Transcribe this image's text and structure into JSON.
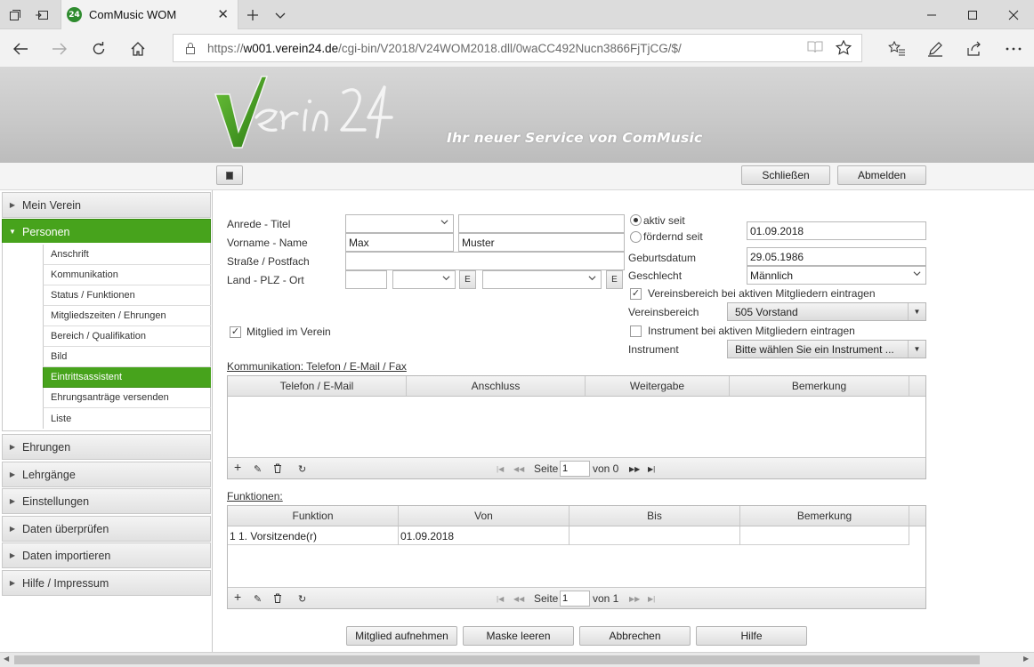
{
  "browser": {
    "tab_title": "ComMusic WOM",
    "favicon_text": "24",
    "url_prefix": "https://",
    "url_domain": "w001.verein24.de",
    "url_path": "/cgi-bin/V2018/V24WOM2018.dll/0waCC492Nucn3866FjTjCG/$/"
  },
  "header": {
    "logo_text": "Verein 24",
    "slogan": "Ihr neuer Service von ComMusic",
    "close_label": "Schließen",
    "logout_label": "Abmelden"
  },
  "sidebar": {
    "top_items": [
      {
        "label": "Mein Verein"
      },
      {
        "label": "Personen"
      }
    ],
    "sub_items": [
      {
        "label": "Anschrift"
      },
      {
        "label": "Kommunikation"
      },
      {
        "label": "Status / Funktionen"
      },
      {
        "label": "Mitgliedszeiten / Ehrungen"
      },
      {
        "label": "Bereich / Qualifikation"
      },
      {
        "label": "Bild"
      },
      {
        "label": "Eintrittsassistent"
      },
      {
        "label": "Ehrungsanträge versenden"
      },
      {
        "label": "Liste"
      }
    ],
    "bottom_items": [
      {
        "label": "Ehrungen"
      },
      {
        "label": "Lehrgänge"
      },
      {
        "label": "Einstellungen"
      },
      {
        "label": "Daten überprüfen"
      },
      {
        "label": "Daten importieren"
      },
      {
        "label": "Hilfe / Impressum"
      }
    ]
  },
  "form": {
    "anrede_label": "Anrede - Titel",
    "anrede_value": "",
    "titel_value": "",
    "name_label": "Vorname - Name",
    "vorname_value": "Max",
    "nachname_value": "Muster",
    "strasse_label": "Straße / Postfach",
    "strasse_value": "",
    "ort_label": "Land - PLZ - Ort",
    "land_value": "",
    "plz_value": "",
    "ort_value": "",
    "e_label": "E",
    "aktiv_label": "aktiv seit",
    "foerdernd_label": "fördernd seit",
    "aktiv_date": "01.09.2018",
    "geburtsdatum_label": "Geburtsdatum",
    "geburtsdatum_value": "29.05.1986",
    "geschlecht_label": "Geschlecht",
    "geschlecht_value": "Männlich",
    "vb_check_label": "Vereinsbereich bei aktiven Mitgliedern eintragen",
    "vb_label": "Vereinsbereich",
    "vb_value": "505 Vorstand",
    "instr_check_label": "Instrument bei aktiven Mitgliedern eintragen",
    "instr_label": "Instrument",
    "instr_value": "Bitte wählen Sie ein Instrument ...",
    "mitglied_label": "Mitglied im Verein",
    "check_mark": "✓"
  },
  "kommunikation": {
    "title": "Kommunikation: Telefon / E-Mail / Fax",
    "columns": [
      "Telefon / E-Mail",
      "Anschluss",
      "Weitergabe",
      "Bemerkung"
    ],
    "page_label": "Seite",
    "page_value": "1",
    "of_label": "von 0"
  },
  "funktionen": {
    "title": "Funktionen:",
    "columns": [
      "Funktion",
      "Von",
      "Bis",
      "Bemerkung"
    ],
    "rows": [
      [
        "1 1. Vorsitzende(r)",
        "01.09.2018",
        "",
        ""
      ]
    ],
    "page_label": "Seite",
    "page_value": "1",
    "of_label": "von 1"
  },
  "actions": {
    "add_member": "Mitglied aufnehmen",
    "clear": "Maske leeren",
    "cancel": "Abbrechen",
    "help": "Hilfe"
  },
  "colors": {
    "accent_green": "#47a31c",
    "banner_grey": "#c9c9c9"
  }
}
